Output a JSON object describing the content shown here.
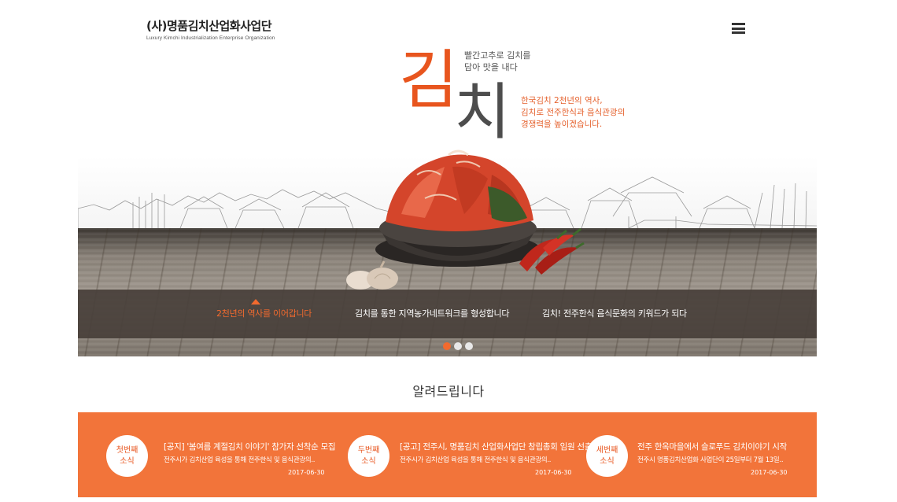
{
  "header": {
    "logo_title": "(사)명품김치산업화사업단",
    "logo_subtitle": "Luxury Kimchi Industrialization Enterprise Organization",
    "menu_icon": "hamburger-icon"
  },
  "hero": {
    "big_char_1": "김",
    "big_char_2": "치",
    "side_note_line1": "빨간고추로 김치를",
    "side_note_line2": "담아 맛을 내다",
    "orange_line1": "한국김치 2천년의 역사,",
    "orange_line2": "김치로 전주한식과 음식관광의",
    "orange_line3": "경쟁력을 높이겠습니다."
  },
  "slides": {
    "items": [
      {
        "label": "2천년의 역사를 이어갑니다",
        "active": true
      },
      {
        "label": "김치를 통한 지역농가네트워크를 형성합니다",
        "active": false
      },
      {
        "label": "김치! 전주한식 음식문화의 키워드가 되다",
        "active": false
      }
    ],
    "pager": {
      "count": 3,
      "current": 1
    }
  },
  "notices": {
    "title": "알려드립니다",
    "items": [
      {
        "badge_line1": "첫번째",
        "badge_line2": "소식",
        "headline": "[공지] '봄여름 계절김치 이야기' 참가자 선착순 모집",
        "summary": "전주시가 김치산업 육성을 통해 전주한식 및 음식관광의..",
        "date": "2017-06-30"
      },
      {
        "badge_line1": "두번째",
        "badge_line2": "소식",
        "headline": "[공고] 전주시, 명품김치 산업화사업단 창립총회 임원 선출",
        "summary": "전주시가 김치산업 육성을 통해 전주한식 및 음식관광의..",
        "date": "2017-06-30"
      },
      {
        "badge_line1": "세번째",
        "badge_line2": "소식",
        "headline": "전주 한옥마을에서 슬로푸드 김치이야기 시작",
        "summary": "전주시 명품김치산업화 사업단이 25일부터 7월 13일..",
        "date": "2017-06-30"
      }
    ]
  },
  "colors": {
    "accent": "#f2743a",
    "brand_orange": "#e8551e",
    "slide_bar": "#48403a"
  }
}
